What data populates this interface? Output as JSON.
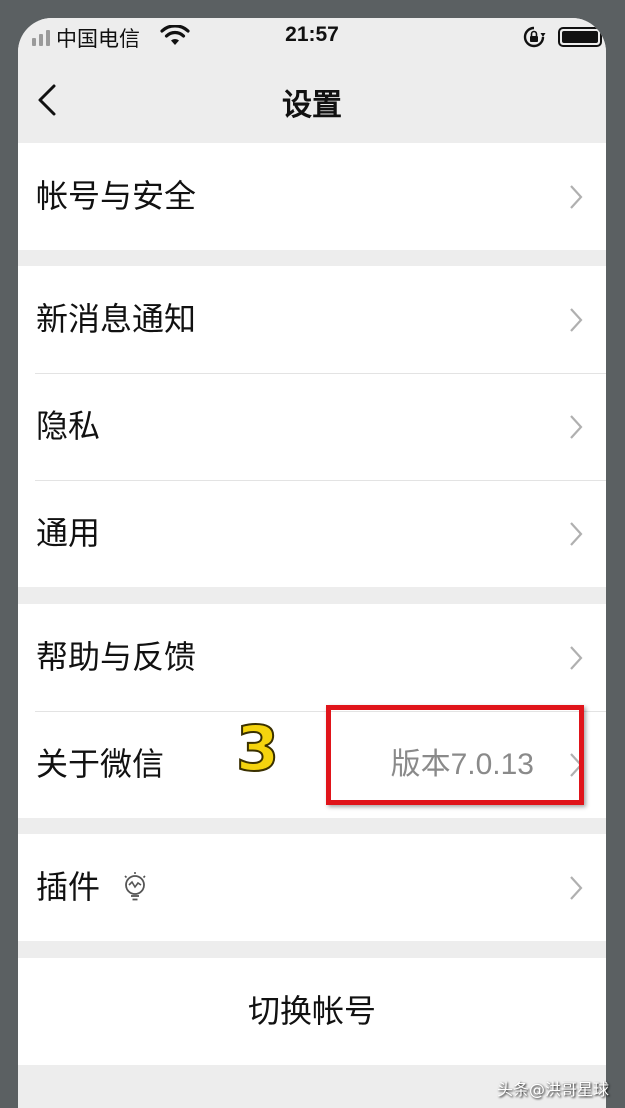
{
  "status_bar": {
    "carrier": "中国电信",
    "time": "21:57"
  },
  "nav": {
    "title": "设置",
    "back_icon": "chevron-left-icon"
  },
  "groups": [
    {
      "items": [
        {
          "label": "帐号与安全"
        }
      ]
    },
    {
      "items": [
        {
          "label": "新消息通知"
        },
        {
          "label": "隐私"
        },
        {
          "label": "通用"
        }
      ]
    },
    {
      "items": [
        {
          "label": "帮助与反馈"
        },
        {
          "label": "关于微信",
          "value": "版本7.0.13"
        }
      ]
    },
    {
      "items": [
        {
          "label": "插件",
          "icon": "plugin-lightbulb-icon"
        }
      ]
    },
    {
      "items": [
        {
          "label": "切换帐号"
        }
      ]
    }
  ],
  "annotation": {
    "step_number": "3",
    "highlight_color": "#e0141a",
    "number_color": "#f5d40e"
  },
  "watermark": "头条@洪哥星球",
  "colors": {
    "background": "#ededed",
    "cell": "#ffffff",
    "secondary_text": "#8a8a8a"
  }
}
